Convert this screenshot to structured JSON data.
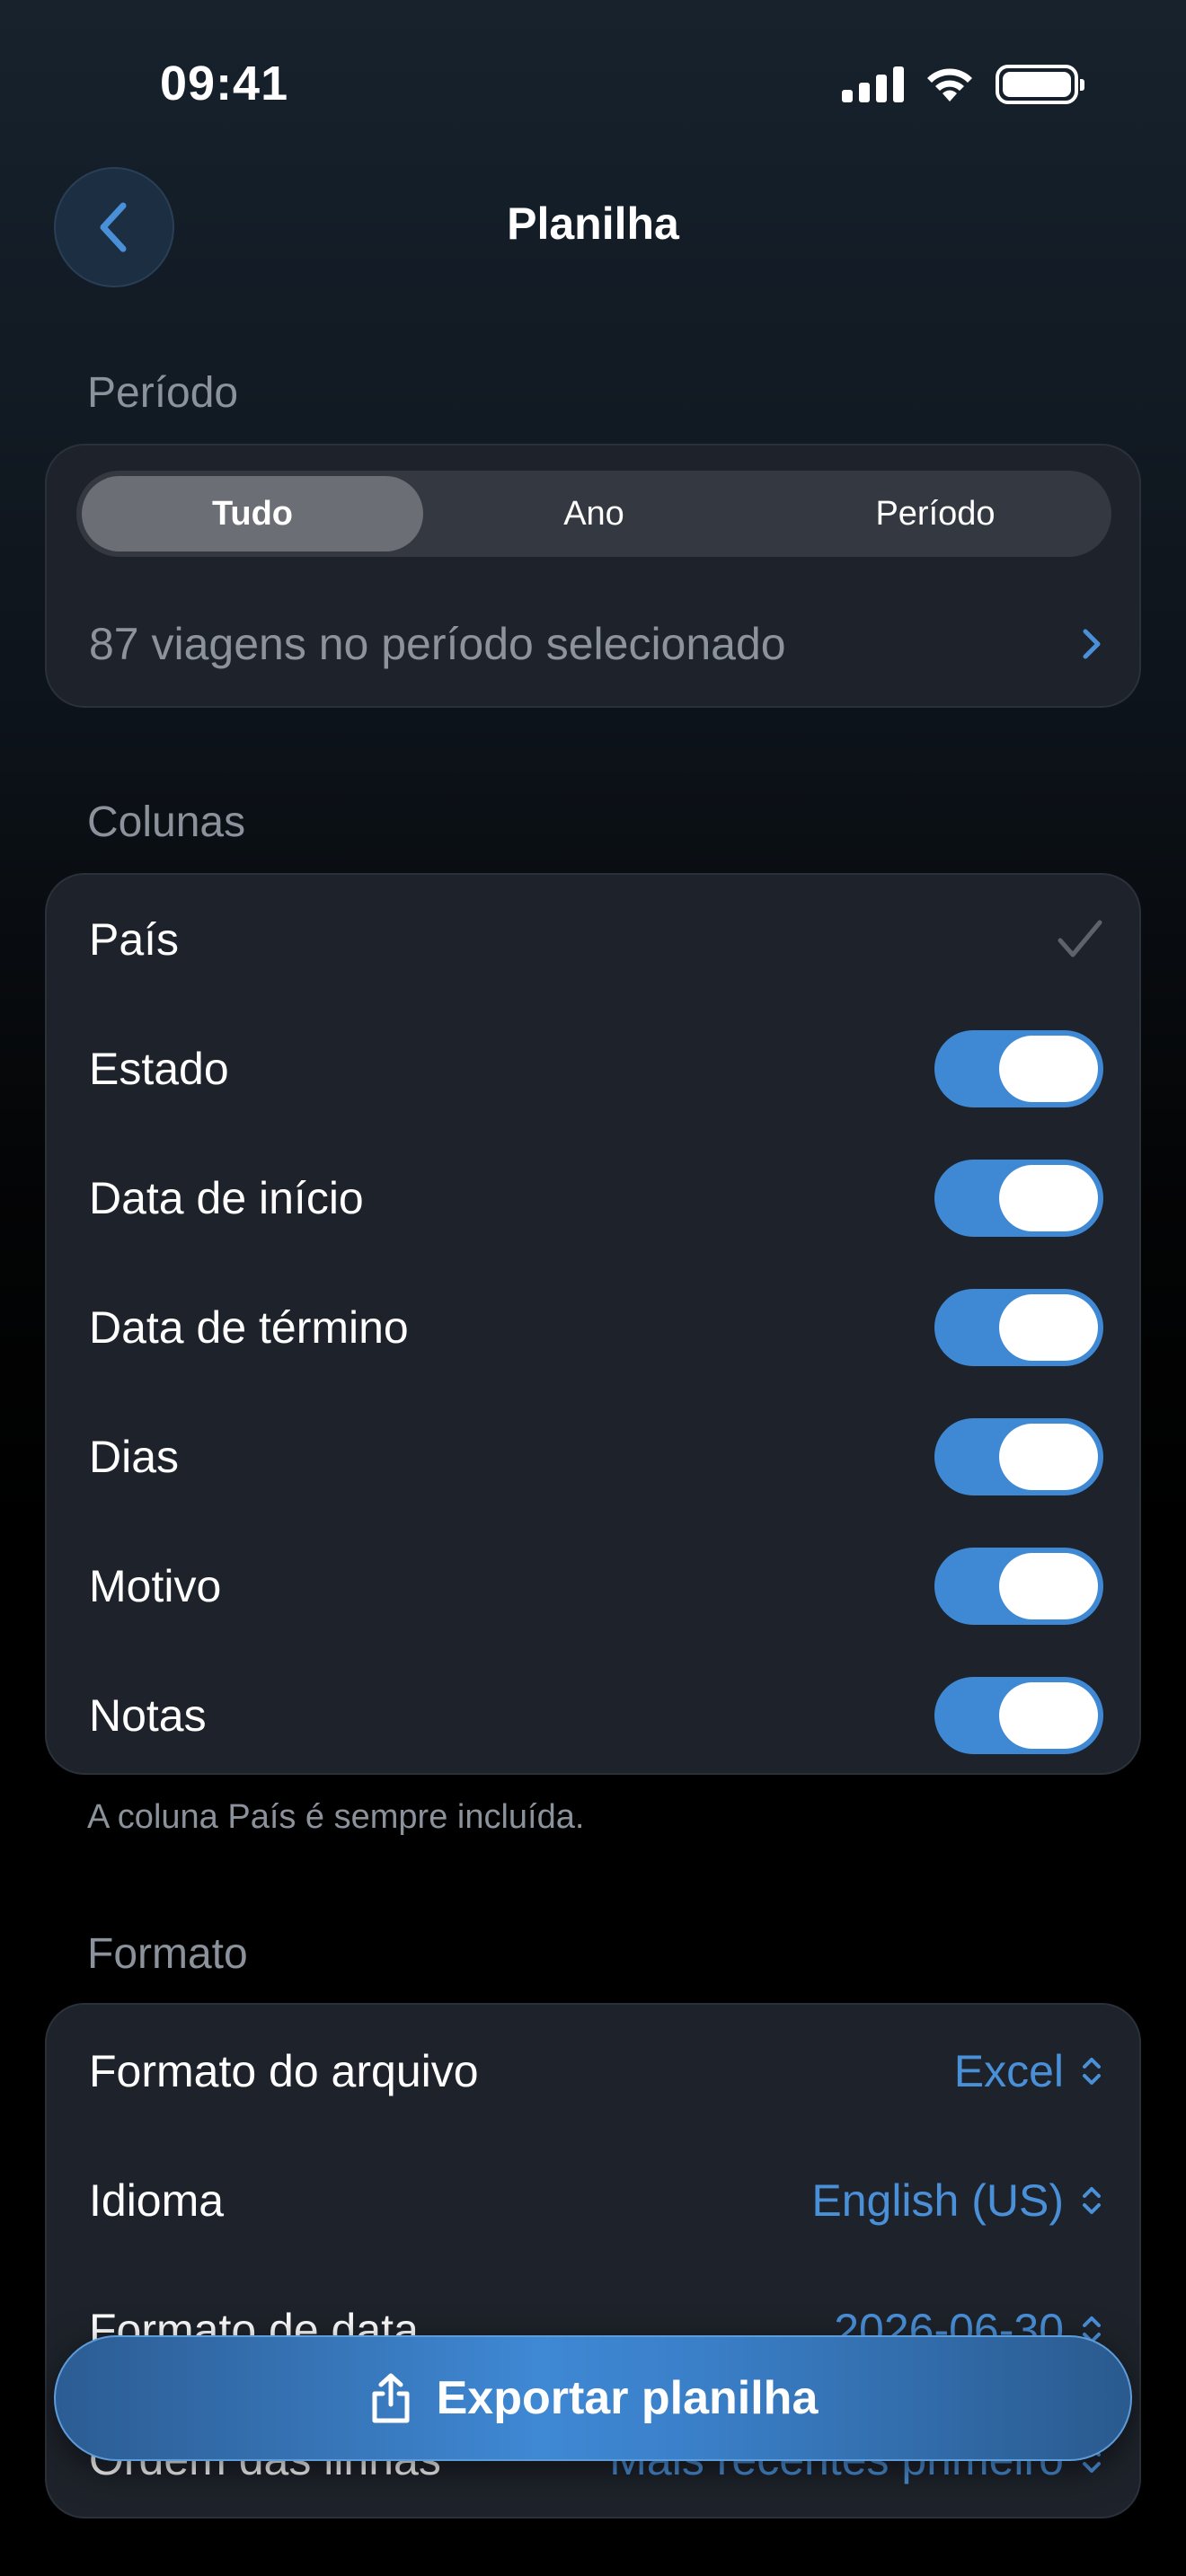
{
  "status_bar": {
    "time": "09:41"
  },
  "nav": {
    "title": "Planilha"
  },
  "period": {
    "section_label": "Período",
    "segments": [
      "Tudo",
      "Ano",
      "Período"
    ],
    "selected_segment": "Tudo",
    "trips_text": "87 viagens no período selecionado"
  },
  "columns": {
    "section_label": "Colunas",
    "items": [
      {
        "label": "País",
        "control": "checkmark",
        "on": true
      },
      {
        "label": "Estado",
        "control": "toggle",
        "on": true
      },
      {
        "label": "Data de início",
        "control": "toggle",
        "on": true
      },
      {
        "label": "Data de término",
        "control": "toggle",
        "on": true
      },
      {
        "label": "Dias",
        "control": "toggle",
        "on": true
      },
      {
        "label": "Motivo",
        "control": "toggle",
        "on": true
      },
      {
        "label": "Notas",
        "control": "toggle",
        "on": true
      }
    ],
    "footnote": "A coluna País é sempre incluída."
  },
  "format": {
    "section_label": "Formato",
    "rows": [
      {
        "label": "Formato do arquivo",
        "value": "Excel"
      },
      {
        "label": "Idioma",
        "value": "English (US)"
      },
      {
        "label": "Formato de data",
        "value": "2026-06-30"
      },
      {
        "label": "Ordem das linhas",
        "value": "Mais recentes primeiro"
      }
    ]
  },
  "export_button": {
    "label": "Exportar planilha"
  },
  "colors": {
    "accent": "#3f88d4",
    "card_bg": "#1e232b",
    "secondary_text": "#8b929b"
  }
}
